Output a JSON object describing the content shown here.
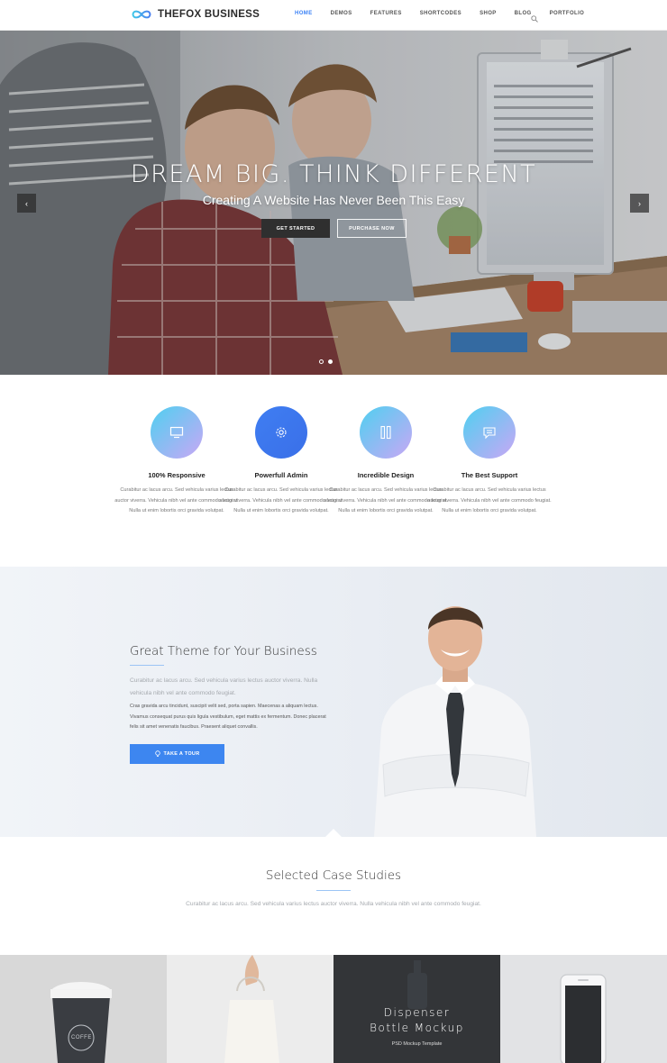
{
  "header": {
    "brand": "THEFOX BUSINESS",
    "nav": [
      "HOME",
      "DEMOS",
      "FEATURES",
      "SHORTCODES",
      "SHOP",
      "BLOG",
      "PORTFOLIO"
    ],
    "active_nav": "HOME",
    "accent_color": "#3b82f6"
  },
  "hero": {
    "title": "DREAM BIG. THINK DIFFERENT",
    "subtitle": "Creating A Website Has Never Been This Easy",
    "primary_button": "GET STARTED",
    "secondary_button": "PURCHASE NOW",
    "prev_arrow": "‹",
    "next_arrow": "›"
  },
  "features": [
    {
      "title": "100% Responsive",
      "icon": "monitor-icon",
      "text": "Curabitur ac lacus arcu. Sed vehicula varius lectus auctor viverra. Vehicula nibh vel ante commodo feugiat. Nulla ut enim lobortis orci gravida volutpat."
    },
    {
      "title": "Powerfull Admin",
      "icon": "gear-icon",
      "text": "Curabitur ac lacus arcu. Sed vehicula varius lectus auctor viverra. Vehicula nibh vel ante commodo feugiat. Nulla ut enim lobortis orci gravida volutpat."
    },
    {
      "title": "Incredible Design",
      "icon": "design-tools-icon",
      "text": "Curabitur ac lacus arcu. Sed vehicula varius lectus auctor viverra. Vehicula nibh vel ante commodo feugiat. Nulla ut enim lobortis orci gravida volutpat."
    },
    {
      "title": "The Best Support",
      "icon": "chat-icon",
      "text": "Curabitur ac lacus arcu. Sed vehicula varius lectus auctor viverra. Vehicula nibh vel ante commodo feugiat. Nulla ut enim lobortis orci gravida volutpat."
    }
  ],
  "theme": {
    "title": "Great Theme for Your Business",
    "lead": "Curabitur ac lacus arcu. Sed vehicula varius lectus auctor viverra. Nulla vehicula nibh vel ante commodo feugiat.",
    "body": "Cras gravida arcu tincidunt, suscipit velit sed, porta sapien. Maecenas a aliquam lectus. Vivamus consequat purus quis ligula vestibulum, eget mattis ex fermentum. Donec placerat felis sit amet venenatis faucibus. Praesent aliquet convallis.",
    "button": "TAKE A TOUR"
  },
  "cases": {
    "title": "Selected Case Studies",
    "text": "Curabitur ac lacus arcu. Sed vehicula varius lectus auctor viverra. Nulla vehicula nibh vel ante commodo feugiat."
  },
  "portfolio": {
    "cup_label": "COFFE",
    "featured_title_line1": "Dispenser",
    "featured_title_line2": "Bottle Mockup",
    "featured_subtitle": "PSD Mockup Template"
  }
}
